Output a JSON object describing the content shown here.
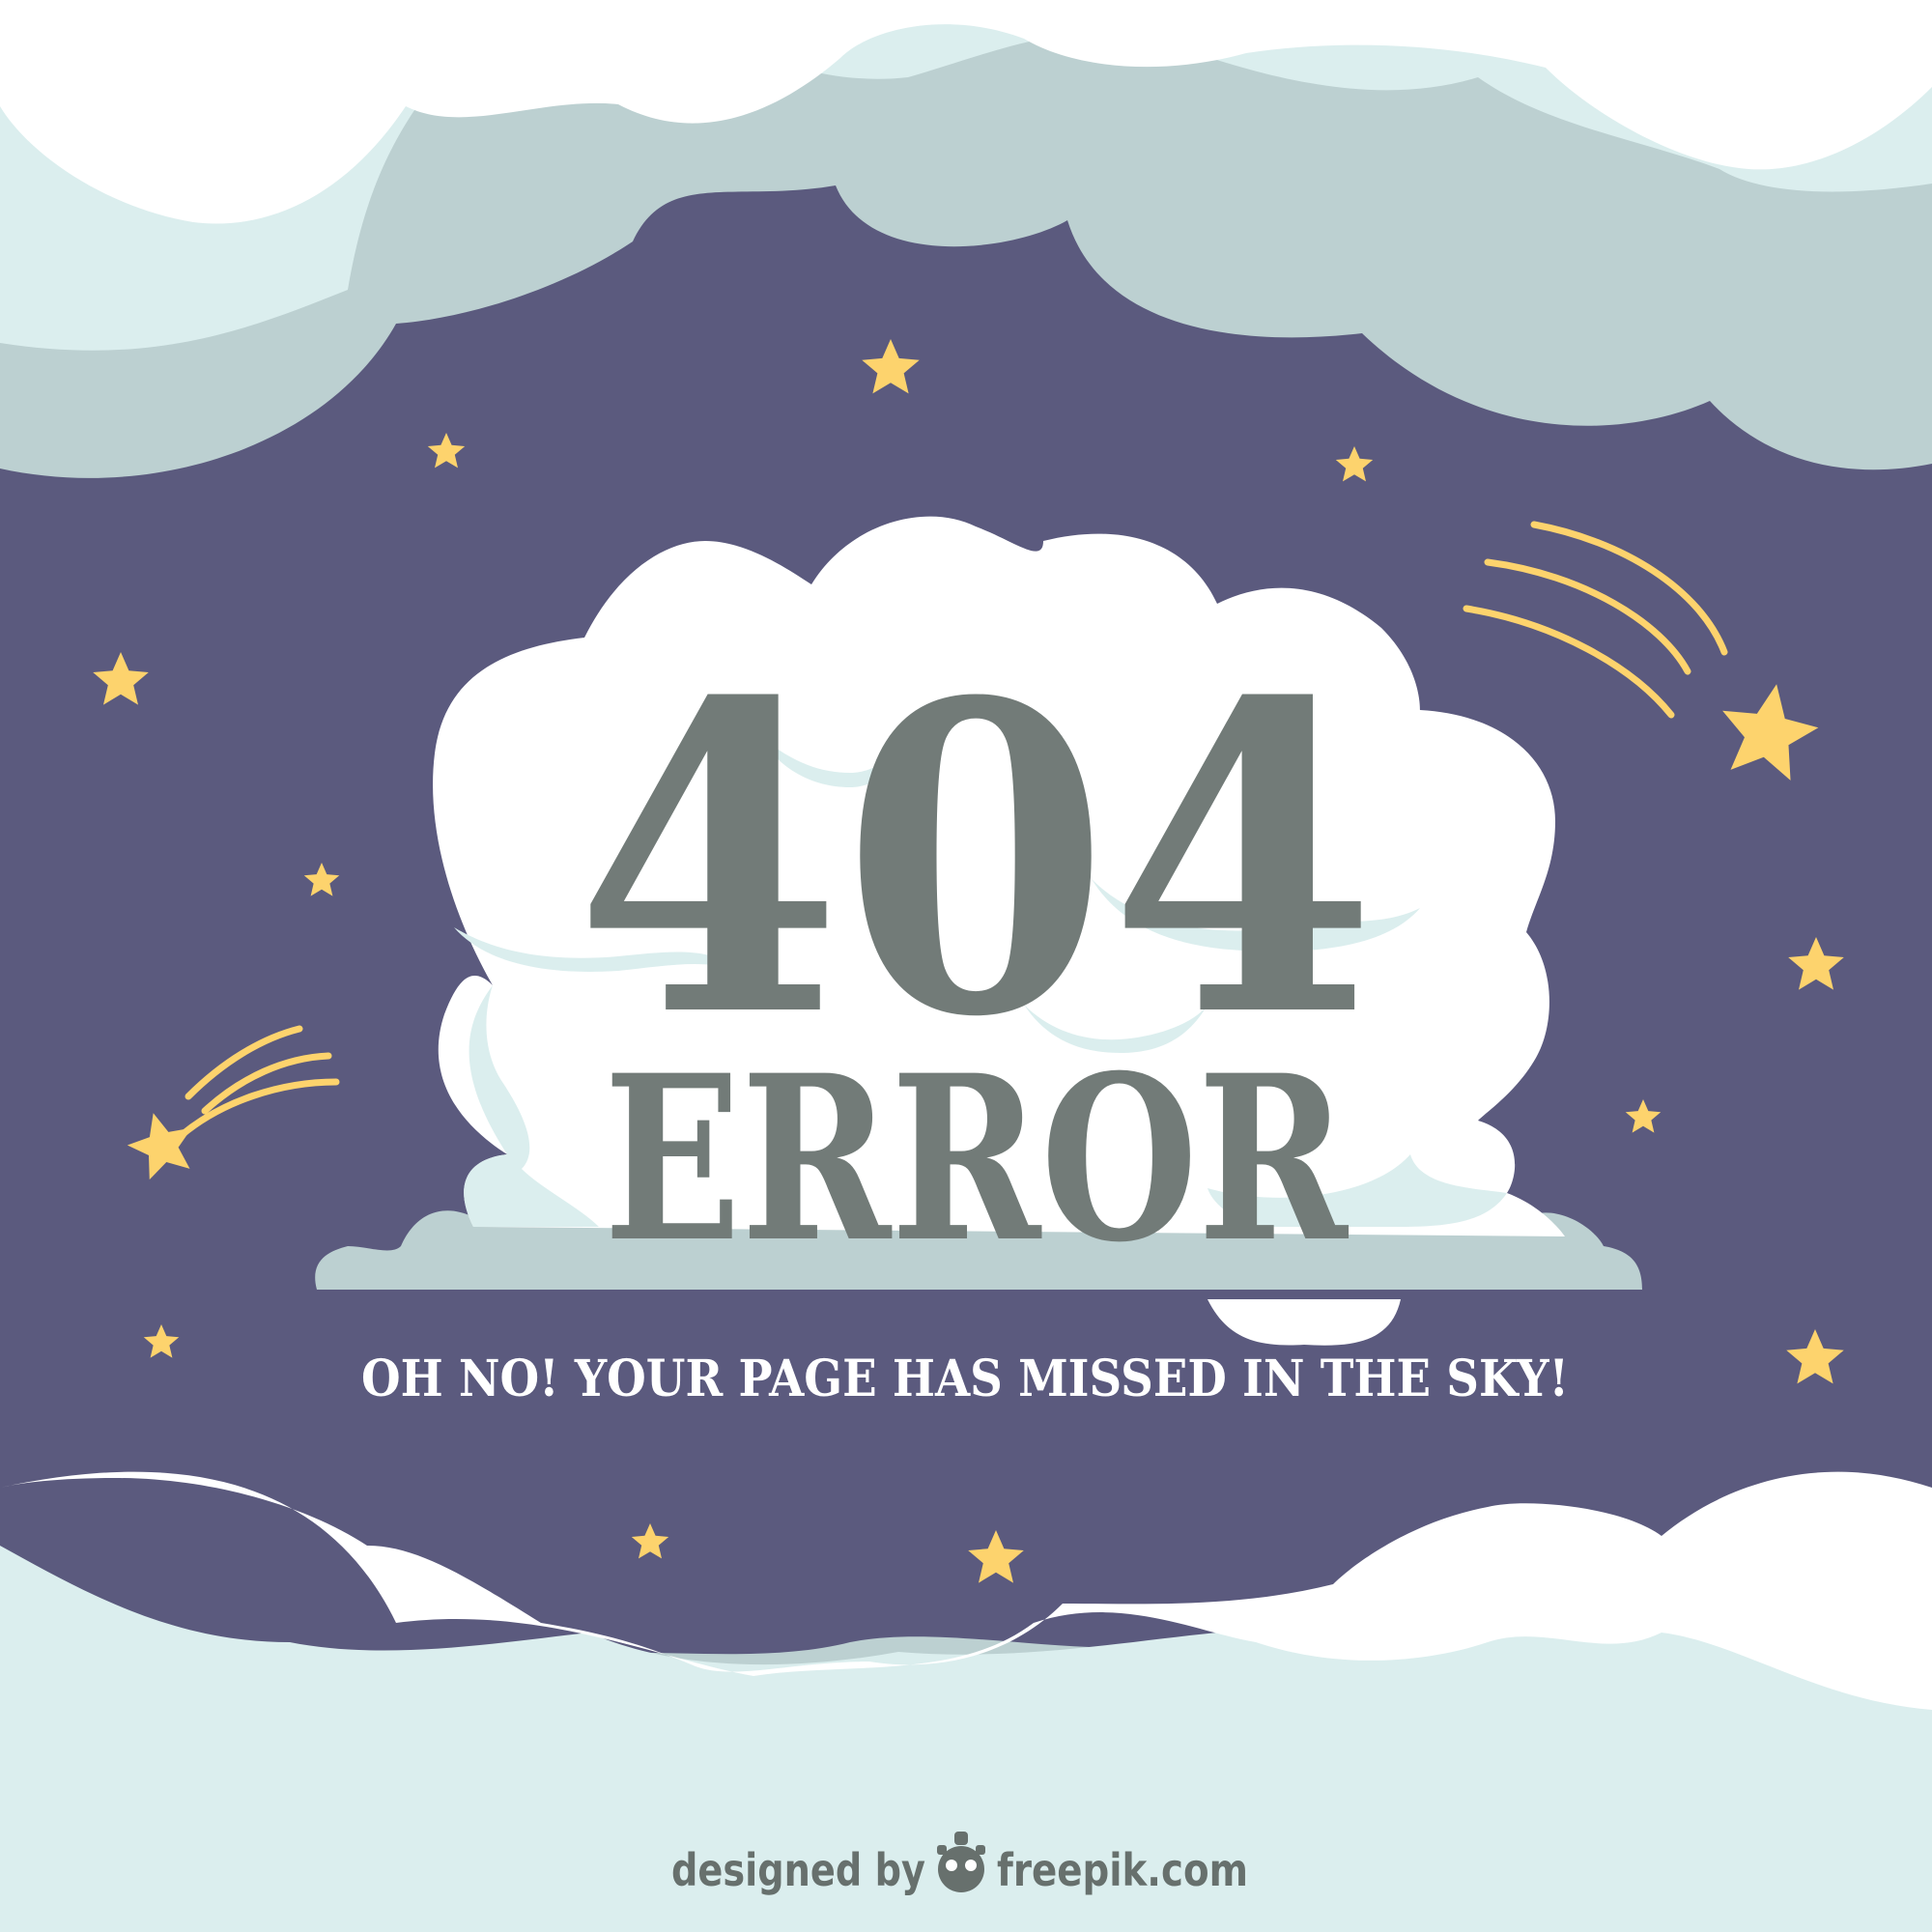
{
  "hero": {
    "code": "404",
    "word": "ERROR"
  },
  "message": "OH NO! YOUR PAGE HAS MISSED IN THE SKY!",
  "credit": {
    "prefix": "designed by",
    "site": "freepik.com",
    "logo_icon": "freepik-logo-icon"
  },
  "colors": {
    "sky": "#5b5a7e",
    "cloud_white": "#ffffff",
    "cloud_light": "#dbeeee",
    "cloud_mid": "#bcd0d1",
    "star": "#fdd36d",
    "hero_text": "#727b78",
    "message_text": "#ffffff",
    "credit_text": "#67706d"
  },
  "icons": [
    "star-icon",
    "shooting-star-icon",
    "freepik-logo-icon"
  ]
}
